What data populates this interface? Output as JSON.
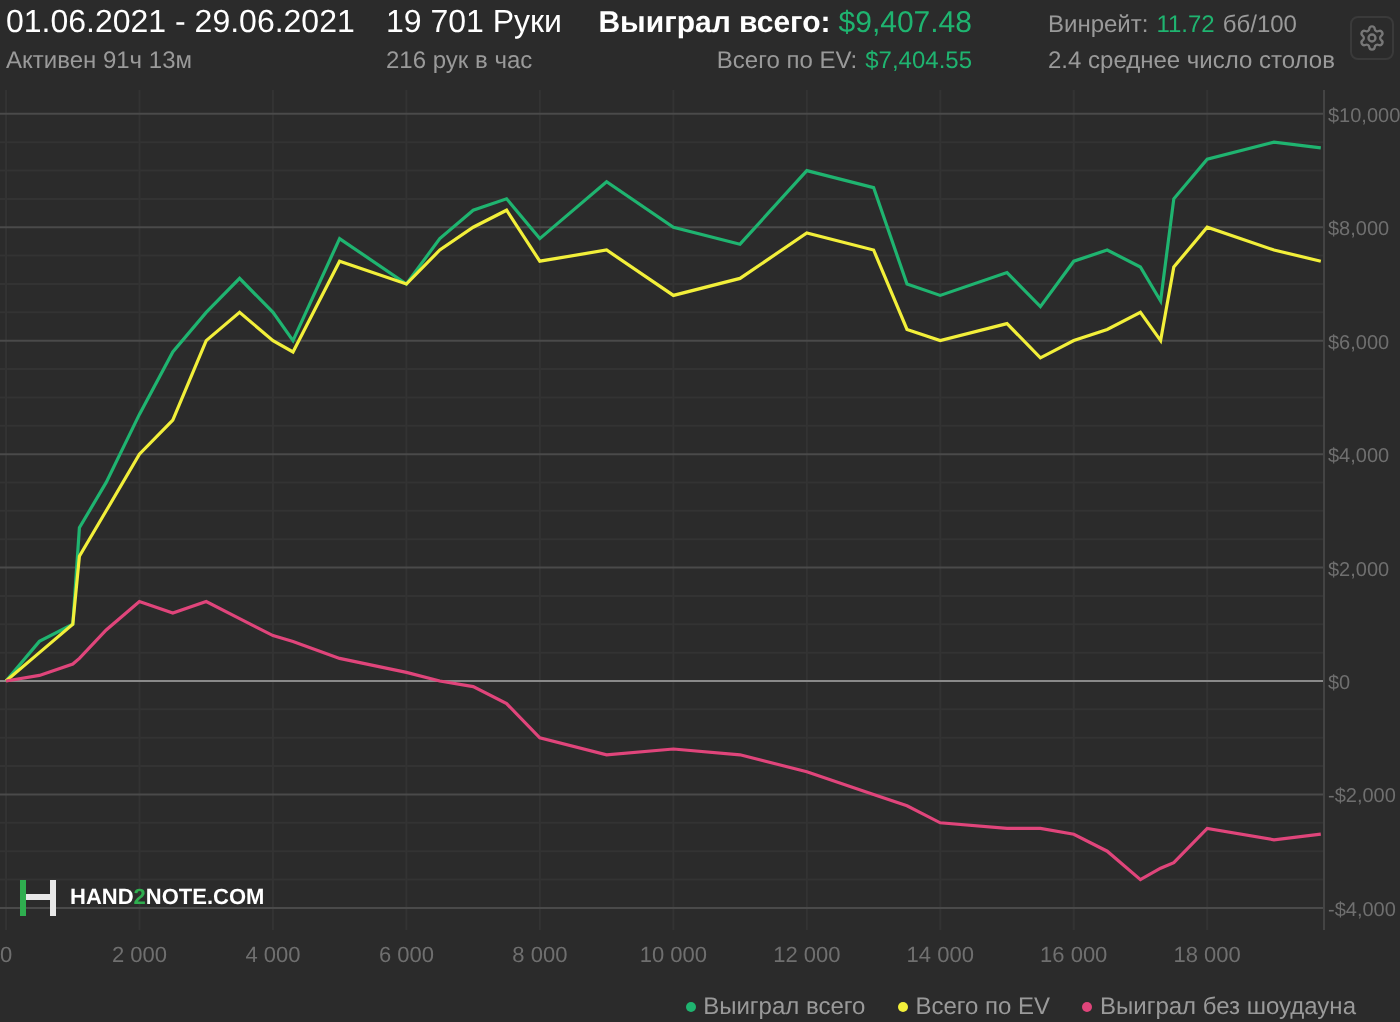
{
  "header": {
    "date_range": "01.06.2021 - 29.06.2021",
    "active_time": "Активен 91ч 13м",
    "hands": "19 701 Руки",
    "hands_per_hour": "216 рук в час",
    "won_label": "Выиграл всего:",
    "won_value": "$9,407.48",
    "ev_label": "Всего по EV:",
    "ev_value": "$7,404.55",
    "winrate_label": "Винрейт:",
    "winrate_value": "11.72",
    "winrate_unit": "бб/100",
    "avg_tables": "2.4 среднее число столов"
  },
  "logo": {
    "before": "HAND",
    "accent": "2",
    "after": "NOTE.COM"
  },
  "chart_data": {
    "type": "line",
    "grid": true,
    "x": [
      0,
      500,
      1000,
      1100,
      1500,
      2000,
      2500,
      3000,
      3500,
      4000,
      4300,
      5000,
      6000,
      6500,
      7000,
      7500,
      8000,
      9000,
      10000,
      11000,
      12000,
      13000,
      13500,
      14000,
      15000,
      15500,
      16000,
      16500,
      17000,
      17300,
      17500,
      18000,
      19000,
      19701
    ],
    "series": [
      {
        "name": "Выиграл всего",
        "color": "#1fb470",
        "values": [
          0,
          700,
          1000,
          2700,
          3500,
          4700,
          5800,
          6500,
          7100,
          6500,
          6000,
          7800,
          7000,
          7800,
          8300,
          8500,
          7800,
          8800,
          8000,
          7700,
          9000,
          8700,
          7000,
          6800,
          7200,
          6600,
          7400,
          7600,
          7300,
          6700,
          8500,
          9200,
          9500,
          9400
        ]
      },
      {
        "name": "Всего по EV",
        "color": "#f2ef3a",
        "values": [
          0,
          500,
          1000,
          2200,
          3000,
          4000,
          4600,
          6000,
          6500,
          6000,
          5800,
          7400,
          7000,
          7600,
          8000,
          8300,
          7400,
          7600,
          6800,
          7100,
          7900,
          7600,
          6200,
          6000,
          6300,
          5700,
          6000,
          6200,
          6500,
          6000,
          7300,
          8000,
          7600,
          7400
        ]
      },
      {
        "name": "Выиграл без шоудауна",
        "color": "#e0457b",
        "values": [
          0,
          100,
          300,
          400,
          900,
          1400,
          1200,
          1400,
          1100,
          800,
          700,
          400,
          150,
          0,
          -100,
          -400,
          -1000,
          -1300,
          -1200,
          -1300,
          -1600,
          -2000,
          -2200,
          -2500,
          -2600,
          -2600,
          -2700,
          -3000,
          -3500,
          -3300,
          -3200,
          -2600,
          -2800,
          -2700
        ]
      }
    ],
    "xlim": [
      -90,
      19750
    ],
    "ylim": [
      -4390,
      10420
    ],
    "xticks": [
      {
        "value": 0,
        "label": "0"
      },
      {
        "value": 2000,
        "label": "2 000"
      },
      {
        "value": 4000,
        "label": "4 000"
      },
      {
        "value": 6000,
        "label": "6 000"
      },
      {
        "value": 8000,
        "label": "8 000"
      },
      {
        "value": 10000,
        "label": "10 000"
      },
      {
        "value": 12000,
        "label": "12 000"
      },
      {
        "value": 14000,
        "label": "14 000"
      },
      {
        "value": 16000,
        "label": "16 000"
      },
      {
        "value": 18000,
        "label": "18 000"
      }
    ],
    "yticks": [
      {
        "value": 10000,
        "label": "$10,000"
      },
      {
        "value": 8000,
        "label": "$8,000"
      },
      {
        "value": 6000,
        "label": "$6,000"
      },
      {
        "value": 4000,
        "label": "$4,000"
      },
      {
        "value": 2000,
        "label": "$2,000"
      },
      {
        "value": 0,
        "label": "$0"
      },
      {
        "value": -2000,
        "label": "-$2,000"
      },
      {
        "value": -4000,
        "label": "-$4,000"
      }
    ]
  }
}
